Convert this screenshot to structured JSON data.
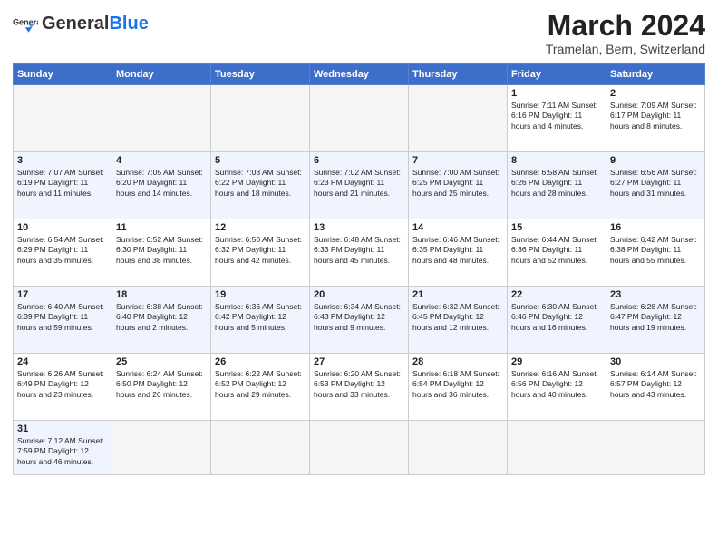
{
  "header": {
    "logo_general": "General",
    "logo_blue": "Blue",
    "month_year": "March 2024",
    "location": "Tramelan, Bern, Switzerland"
  },
  "weekdays": [
    "Sunday",
    "Monday",
    "Tuesday",
    "Wednesday",
    "Thursday",
    "Friday",
    "Saturday"
  ],
  "weeks": [
    [
      {
        "day": "",
        "info": ""
      },
      {
        "day": "",
        "info": ""
      },
      {
        "day": "",
        "info": ""
      },
      {
        "day": "",
        "info": ""
      },
      {
        "day": "",
        "info": ""
      },
      {
        "day": "1",
        "info": "Sunrise: 7:11 AM\nSunset: 6:16 PM\nDaylight: 11 hours and 4 minutes."
      },
      {
        "day": "2",
        "info": "Sunrise: 7:09 AM\nSunset: 6:17 PM\nDaylight: 11 hours and 8 minutes."
      }
    ],
    [
      {
        "day": "3",
        "info": "Sunrise: 7:07 AM\nSunset: 6:19 PM\nDaylight: 11 hours and 11 minutes."
      },
      {
        "day": "4",
        "info": "Sunrise: 7:05 AM\nSunset: 6:20 PM\nDaylight: 11 hours and 14 minutes."
      },
      {
        "day": "5",
        "info": "Sunrise: 7:03 AM\nSunset: 6:22 PM\nDaylight: 11 hours and 18 minutes."
      },
      {
        "day": "6",
        "info": "Sunrise: 7:02 AM\nSunset: 6:23 PM\nDaylight: 11 hours and 21 minutes."
      },
      {
        "day": "7",
        "info": "Sunrise: 7:00 AM\nSunset: 6:25 PM\nDaylight: 11 hours and 25 minutes."
      },
      {
        "day": "8",
        "info": "Sunrise: 6:58 AM\nSunset: 6:26 PM\nDaylight: 11 hours and 28 minutes."
      },
      {
        "day": "9",
        "info": "Sunrise: 6:56 AM\nSunset: 6:27 PM\nDaylight: 11 hours and 31 minutes."
      }
    ],
    [
      {
        "day": "10",
        "info": "Sunrise: 6:54 AM\nSunset: 6:29 PM\nDaylight: 11 hours and 35 minutes."
      },
      {
        "day": "11",
        "info": "Sunrise: 6:52 AM\nSunset: 6:30 PM\nDaylight: 11 hours and 38 minutes."
      },
      {
        "day": "12",
        "info": "Sunrise: 6:50 AM\nSunset: 6:32 PM\nDaylight: 11 hours and 42 minutes."
      },
      {
        "day": "13",
        "info": "Sunrise: 6:48 AM\nSunset: 6:33 PM\nDaylight: 11 hours and 45 minutes."
      },
      {
        "day": "14",
        "info": "Sunrise: 6:46 AM\nSunset: 6:35 PM\nDaylight: 11 hours and 48 minutes."
      },
      {
        "day": "15",
        "info": "Sunrise: 6:44 AM\nSunset: 6:36 PM\nDaylight: 11 hours and 52 minutes."
      },
      {
        "day": "16",
        "info": "Sunrise: 6:42 AM\nSunset: 6:38 PM\nDaylight: 11 hours and 55 minutes."
      }
    ],
    [
      {
        "day": "17",
        "info": "Sunrise: 6:40 AM\nSunset: 6:39 PM\nDaylight: 11 hours and 59 minutes."
      },
      {
        "day": "18",
        "info": "Sunrise: 6:38 AM\nSunset: 6:40 PM\nDaylight: 12 hours and 2 minutes."
      },
      {
        "day": "19",
        "info": "Sunrise: 6:36 AM\nSunset: 6:42 PM\nDaylight: 12 hours and 5 minutes."
      },
      {
        "day": "20",
        "info": "Sunrise: 6:34 AM\nSunset: 6:43 PM\nDaylight: 12 hours and 9 minutes."
      },
      {
        "day": "21",
        "info": "Sunrise: 6:32 AM\nSunset: 6:45 PM\nDaylight: 12 hours and 12 minutes."
      },
      {
        "day": "22",
        "info": "Sunrise: 6:30 AM\nSunset: 6:46 PM\nDaylight: 12 hours and 16 minutes."
      },
      {
        "day": "23",
        "info": "Sunrise: 6:28 AM\nSunset: 6:47 PM\nDaylight: 12 hours and 19 minutes."
      }
    ],
    [
      {
        "day": "24",
        "info": "Sunrise: 6:26 AM\nSunset: 6:49 PM\nDaylight: 12 hours and 23 minutes."
      },
      {
        "day": "25",
        "info": "Sunrise: 6:24 AM\nSunset: 6:50 PM\nDaylight: 12 hours and 26 minutes."
      },
      {
        "day": "26",
        "info": "Sunrise: 6:22 AM\nSunset: 6:52 PM\nDaylight: 12 hours and 29 minutes."
      },
      {
        "day": "27",
        "info": "Sunrise: 6:20 AM\nSunset: 6:53 PM\nDaylight: 12 hours and 33 minutes."
      },
      {
        "day": "28",
        "info": "Sunrise: 6:18 AM\nSunset: 6:54 PM\nDaylight: 12 hours and 36 minutes."
      },
      {
        "day": "29",
        "info": "Sunrise: 6:16 AM\nSunset: 6:56 PM\nDaylight: 12 hours and 40 minutes."
      },
      {
        "day": "30",
        "info": "Sunrise: 6:14 AM\nSunset: 6:57 PM\nDaylight: 12 hours and 43 minutes."
      }
    ],
    [
      {
        "day": "31",
        "info": "Sunrise: 7:12 AM\nSunset: 7:59 PM\nDaylight: 12 hours and 46 minutes."
      },
      {
        "day": "",
        "info": ""
      },
      {
        "day": "",
        "info": ""
      },
      {
        "day": "",
        "info": ""
      },
      {
        "day": "",
        "info": ""
      },
      {
        "day": "",
        "info": ""
      },
      {
        "day": "",
        "info": ""
      }
    ]
  ]
}
